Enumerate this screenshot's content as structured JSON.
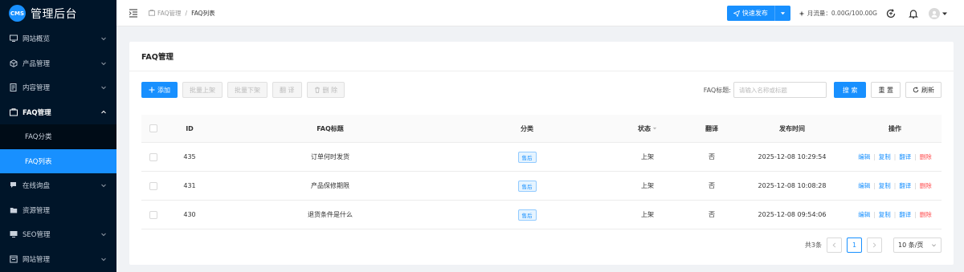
{
  "app": {
    "logo_badge": "CMS",
    "title": "管理后台"
  },
  "sidebar": {
    "items": [
      {
        "label": "网站概览",
        "icon": "dashboard-icon",
        "expandable": true
      },
      {
        "label": "产品管理",
        "icon": "cube-icon",
        "expandable": true
      },
      {
        "label": "内容管理",
        "icon": "document-icon",
        "expandable": true
      },
      {
        "label": "FAQ管理",
        "icon": "faq-icon",
        "expandable": true,
        "open": true,
        "children": [
          {
            "label": "FAQ分类"
          },
          {
            "label": "FAQ列表",
            "active": true
          }
        ]
      },
      {
        "label": "在线询盘",
        "icon": "chat-icon",
        "expandable": true
      },
      {
        "label": "资源管理",
        "icon": "folder-icon",
        "expandable": false
      },
      {
        "label": "SEO管理",
        "icon": "monitor-icon",
        "expandable": true
      },
      {
        "label": "网站管理",
        "icon": "window-icon",
        "expandable": true
      }
    ]
  },
  "topbar": {
    "breadcrumb": {
      "parent": "FAQ管理",
      "sep": "/",
      "current": "FAQ列表"
    },
    "publish_label": "快速发布",
    "traffic_label": "月流量：0.00G/100.00G"
  },
  "card": {
    "title": "FAQ管理"
  },
  "toolbar": {
    "add": "添加",
    "batch_on": "批量上架",
    "batch_off": "批量下架",
    "translate": "翻 译",
    "delete": "删 除",
    "search_label": "FAQ标题:",
    "search_placeholder": "请输入名称或标题",
    "search_btn": "搜 索",
    "reset_btn": "重 置",
    "refresh_btn": "刷新"
  },
  "table": {
    "columns": [
      "ID",
      "FAQ标题",
      "分类",
      "状态",
      "翻译",
      "发布时间",
      "操作"
    ],
    "rows": [
      {
        "id": "435",
        "title": "订单何时发货",
        "category": "售后",
        "status": "上架",
        "translated": "否",
        "time": "2025-12-08 10:29:54"
      },
      {
        "id": "431",
        "title": "产品保修期限",
        "category": "售后",
        "status": "上架",
        "translated": "否",
        "time": "2025-12-08 10:08:28"
      },
      {
        "id": "430",
        "title": "退货条件是什么",
        "category": "售后",
        "status": "上架",
        "translated": "否",
        "time": "2025-12-08 09:54:06"
      }
    ],
    "ops": {
      "edit": "编辑",
      "copy": "复制",
      "translate": "翻译",
      "delete": "删除",
      "sep": "|"
    }
  },
  "pagination": {
    "total": "共3条",
    "current_page": "1",
    "page_size": "10 条/页"
  },
  "colors": {
    "sidebar_bg": "#001529",
    "primary": "#1890ff",
    "danger": "#ff4d4f"
  }
}
